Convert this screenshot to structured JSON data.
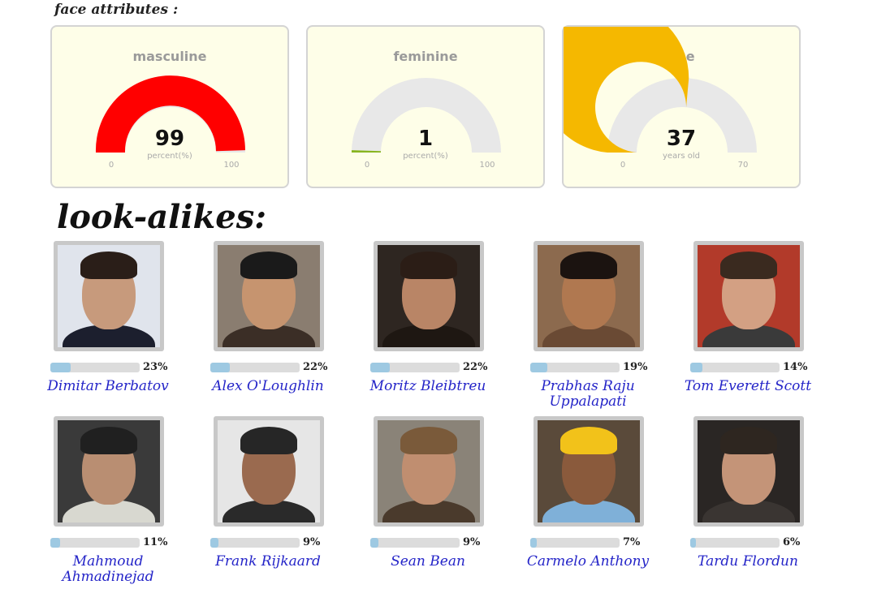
{
  "face_attributes": {
    "heading": "face attributes :",
    "gauges": [
      {
        "title": "masculine",
        "value": 99,
        "display": "99",
        "unit": "percent(%)",
        "min": 0,
        "max": 100,
        "min_label": "0",
        "max_label": "100",
        "color": "#ff0000"
      },
      {
        "title": "feminine",
        "value": 1,
        "display": "1",
        "unit": "percent(%)",
        "min": 0,
        "max": 100,
        "min_label": "0",
        "max_label": "100",
        "color": "#88b520"
      },
      {
        "title": "age",
        "value": 37,
        "display": "37",
        "unit": "years old",
        "min": 0,
        "max": 70,
        "min_label": "0",
        "max_label": "70",
        "color": "#f5b800"
      }
    ],
    "track_color": "#e8e8e8"
  },
  "lookalikes": {
    "heading": "look-alikes:",
    "items": [
      {
        "name": "Dimitar Berbatov",
        "percent": 23,
        "percent_label": "23%",
        "skin": "#c79a7c",
        "hair": "#2a1e18",
        "clothes": "#1c1f2e",
        "bg": "#e0e4ec"
      },
      {
        "name": "Alex O'Loughlin",
        "percent": 22,
        "percent_label": "22%",
        "skin": "#c6946f",
        "hair": "#1a1a1a",
        "clothes": "#3b2e26",
        "bg": "#8a7d70"
      },
      {
        "name": "Moritz Bleibtreu",
        "percent": 22,
        "percent_label": "22%",
        "skin": "#b98566",
        "hair": "#2b1d16",
        "clothes": "#1e1712",
        "bg": "#2e2621"
      },
      {
        "name": "Prabhas Raju Uppalapati",
        "percent": 19,
        "percent_label": "19%",
        "skin": "#b07850",
        "hair": "#1b1310",
        "clothes": "#6a4a34",
        "bg": "#8c6a4e"
      },
      {
        "name": "Tom Everett Scott",
        "percent": 14,
        "percent_label": "14%",
        "skin": "#d3a083",
        "hair": "#3a2a1f",
        "clothes": "#3a3a3a",
        "bg": "#b23a2a"
      },
      {
        "name": "Mahmoud Ahmadinejad",
        "percent": 11,
        "percent_label": "11%",
        "skin": "#b98e72",
        "hair": "#202020",
        "clothes": "#d8d8d0",
        "bg": "#3a3a3a"
      },
      {
        "name": "Frank Rijkaard",
        "percent": 9,
        "percent_label": "9%",
        "skin": "#9a6a4f",
        "hair": "#262626",
        "clothes": "#2a2a2a",
        "bg": "#e6e6e6"
      },
      {
        "name": "Sean Bean",
        "percent": 9,
        "percent_label": "9%",
        "skin": "#c08e70",
        "hair": "#7a5a3a",
        "clothes": "#4a3a2c",
        "bg": "#8a8378"
      },
      {
        "name": "Carmelo Anthony",
        "percent": 7,
        "percent_label": "7%",
        "skin": "#8a5a3c",
        "hair": "#f2c21a",
        "clothes": "#7fb0d8",
        "bg": "#5a4a3a"
      },
      {
        "name": "Tardu Flordun",
        "percent": 6,
        "percent_label": "6%",
        "skin": "#c49478",
        "hair": "#2e2620",
        "clothes": "#3a3532",
        "bg": "#2a2624"
      }
    ]
  }
}
